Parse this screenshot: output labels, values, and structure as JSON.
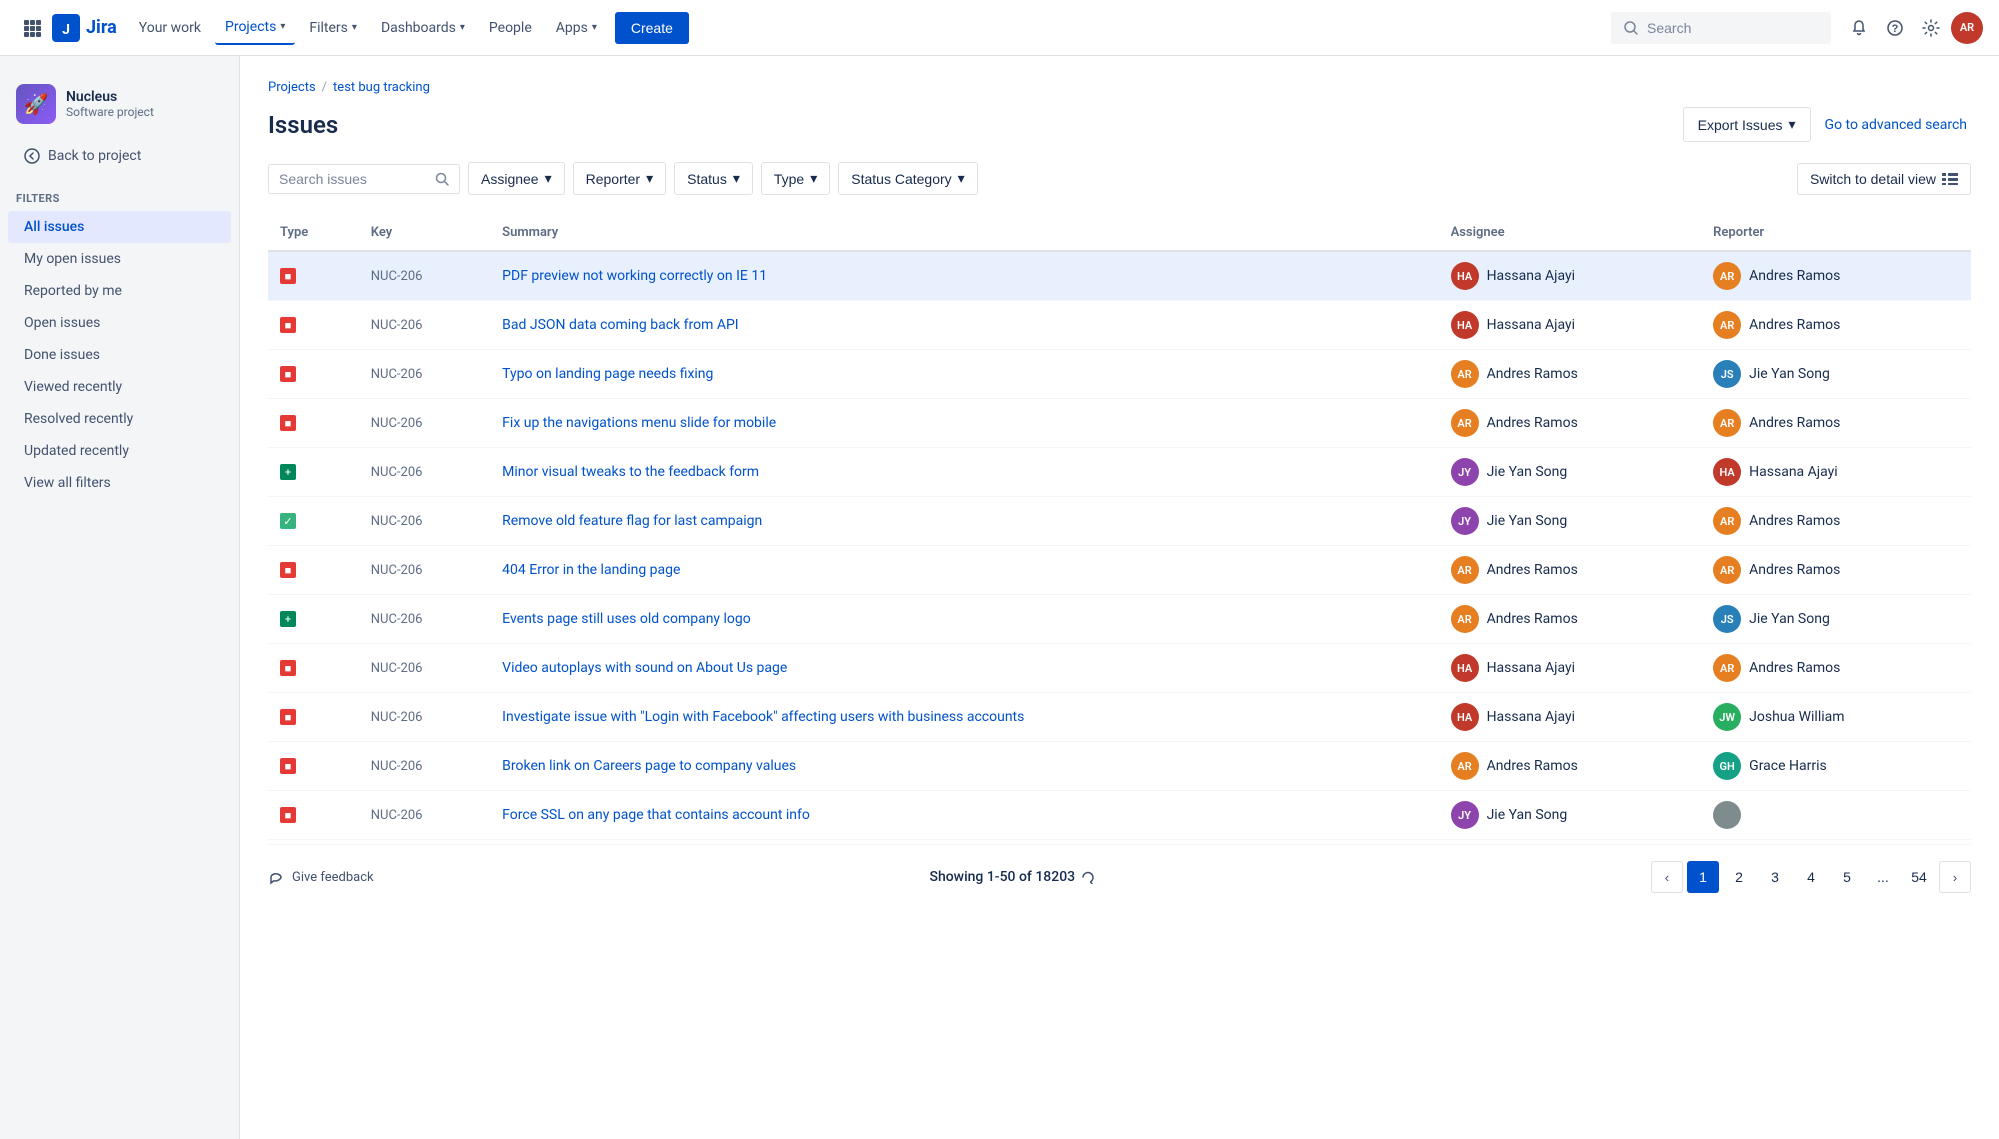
{
  "nav": {
    "logo_text": "Jira",
    "items": [
      {
        "label": "Your work",
        "active": false
      },
      {
        "label": "Projects",
        "active": true
      },
      {
        "label": "Filters",
        "active": false
      },
      {
        "label": "Dashboards",
        "active": false
      },
      {
        "label": "People",
        "active": false
      },
      {
        "label": "Apps",
        "active": false
      }
    ],
    "create_label": "Create",
    "search_placeholder": "Search"
  },
  "sidebar": {
    "project_name": "Nucleus",
    "project_type": "Software project",
    "back_label": "Back to project",
    "section_title": "Filters",
    "nav_items": [
      {
        "label": "All issues",
        "active": true
      },
      {
        "label": "My open issues",
        "active": false
      },
      {
        "label": "Reported by me",
        "active": false
      },
      {
        "label": "Open issues",
        "active": false
      },
      {
        "label": "Done issues",
        "active": false
      },
      {
        "label": "Viewed recently",
        "active": false
      },
      {
        "label": "Resolved recently",
        "active": false
      },
      {
        "label": "Updated recently",
        "active": false
      },
      {
        "label": "View all filters",
        "active": false
      }
    ]
  },
  "breadcrumb": {
    "items": [
      "Projects",
      "test bug tracking"
    ]
  },
  "page": {
    "title": "Issues",
    "export_label": "Export Issues",
    "advanced_search_label": "Go to advanced search"
  },
  "filters": {
    "search_placeholder": "Search issues",
    "assignee_label": "Assignee",
    "reporter_label": "Reporter",
    "status_label": "Status",
    "type_label": "Type",
    "status_category_label": "Status Category",
    "detail_view_label": "Switch to detail view"
  },
  "table": {
    "headers": [
      "Type",
      "Key",
      "Summary",
      "Assignee",
      "Reporter"
    ],
    "rows": [
      {
        "type": "bug",
        "key": "NUC-206",
        "summary": "PDF preview not working correctly on IE 11",
        "assignee": "Hassana Ajayi",
        "assignee_color": "#c0392b",
        "assignee_initials": "HA",
        "reporter": "Andres Ramos",
        "reporter_color": "#e67e22",
        "reporter_initials": "AR",
        "selected": true
      },
      {
        "type": "bug",
        "key": "NUC-206",
        "summary": "Bad JSON data coming back from API",
        "assignee": "Hassana Ajayi",
        "assignee_color": "#c0392b",
        "assignee_initials": "HA",
        "reporter": "Andres Ramos",
        "reporter_color": "#e67e22",
        "reporter_initials": "AR",
        "selected": false
      },
      {
        "type": "bug",
        "key": "NUC-206",
        "summary": "Typo on landing page needs fixing",
        "assignee": "Andres Ramos",
        "assignee_color": "#e67e22",
        "assignee_initials": "AR",
        "reporter": "Jie Yan Song",
        "reporter_color": "#2980b9",
        "reporter_initials": "JS",
        "selected": false
      },
      {
        "type": "bug",
        "key": "NUC-206",
        "summary": "Fix up the navigations menu slide for mobile",
        "assignee": "Andres Ramos",
        "assignee_color": "#e67e22",
        "assignee_initials": "AR",
        "reporter": "Andres Ramos",
        "reporter_color": "#e67e22",
        "reporter_initials": "AR",
        "selected": false
      },
      {
        "type": "improvement",
        "key": "NUC-206",
        "summary": "Minor visual tweaks to the feedback form",
        "assignee": "Jie Yan Song",
        "assignee_color": "#8e44ad",
        "assignee_initials": "JY",
        "reporter": "Hassana Ajayi",
        "reporter_color": "#c0392b",
        "reporter_initials": "HA",
        "selected": false
      },
      {
        "type": "done",
        "key": "NUC-206",
        "summary": "Remove old feature flag for last campaign",
        "assignee": "Jie Yan Song",
        "assignee_color": "#8e44ad",
        "assignee_initials": "JY",
        "reporter": "Andres Ramos",
        "reporter_color": "#e67e22",
        "reporter_initials": "AR",
        "selected": false
      },
      {
        "type": "bug",
        "key": "NUC-206",
        "summary": "404 Error in the landing page",
        "assignee": "Andres Ramos",
        "assignee_color": "#e67e22",
        "assignee_initials": "AR",
        "reporter": "Andres Ramos",
        "reporter_color": "#e67e22",
        "reporter_initials": "AR",
        "selected": false
      },
      {
        "type": "improvement",
        "key": "NUC-206",
        "summary": "Events page still uses old company logo",
        "assignee": "Andres Ramos",
        "assignee_color": "#e67e22",
        "assignee_initials": "AR",
        "reporter": "Jie Yan Song",
        "reporter_color": "#2980b9",
        "reporter_initials": "JS",
        "selected": false
      },
      {
        "type": "bug",
        "key": "NUC-206",
        "summary": "Video autoplays with sound on About Us page",
        "assignee": "Hassana Ajayi",
        "assignee_color": "#c0392b",
        "assignee_initials": "HA",
        "reporter": "Andres Ramos",
        "reporter_color": "#e67e22",
        "reporter_initials": "AR",
        "selected": false
      },
      {
        "type": "bug",
        "key": "NUC-206",
        "summary": "Investigate issue with \"Login with Facebook\" affecting users with business accounts",
        "assignee": "Hassana Ajayi",
        "assignee_color": "#c0392b",
        "assignee_initials": "HA",
        "reporter": "Joshua William",
        "reporter_color": "#27ae60",
        "reporter_initials": "JW",
        "selected": false
      },
      {
        "type": "bug",
        "key": "NUC-206",
        "summary": "Broken link on Careers page to company values",
        "assignee": "Andres Ramos",
        "assignee_color": "#e67e22",
        "assignee_initials": "AR",
        "reporter": "Grace Harris",
        "reporter_color": "#16a085",
        "reporter_initials": "GH",
        "selected": false
      },
      {
        "type": "bug",
        "key": "NUC-206",
        "summary": "Force SSL on any page that contains account info",
        "assignee": "Jie Yan Song",
        "assignee_color": "#8e44ad",
        "assignee_initials": "JY",
        "reporter": "",
        "reporter_color": "#7f8c8d",
        "reporter_initials": "",
        "selected": false
      }
    ]
  },
  "pagination": {
    "feedback_label": "Give feedback",
    "showing_text": "Showing 1-50 of 18203",
    "pages": [
      "1",
      "2",
      "3",
      "4",
      "5",
      "...",
      "54"
    ],
    "current_page": "1"
  }
}
